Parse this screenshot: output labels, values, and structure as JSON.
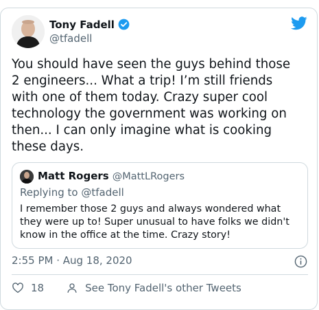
{
  "author": {
    "name": "Tony Fadell",
    "handle": "@tfadell",
    "verified_color": "#1d9bf0"
  },
  "tweet": {
    "text": "You should have seen the guys behind those\n2 engineers... What a trip! I’m still friends\nwith one of them today. Crazy super cool\ntechnology the government was working on\nthen... I can only imagine what is cooking\nthese days.",
    "timestamp": "2:55 PM · Aug 18, 2020"
  },
  "quoted": {
    "name": "Matt Rogers",
    "handle": "@MattLRogers",
    "replying_to": "Replying to @tfadell",
    "text": "I remember those 2 guys and always wondered what they were up to! Super unusual to have folks we didn't know in the office at the time. Crazy story!"
  },
  "actions": {
    "like_count": "18",
    "other_tweets_label": "See Tony Fadell's other Tweets"
  },
  "icons": {
    "brand": "twitter-bird-icon",
    "verified": "verified-badge-icon",
    "info": "info-icon",
    "like": "heart-icon",
    "profile": "person-icon"
  },
  "colors": {
    "brand": "#1d9bf0",
    "text": "#0f1419",
    "muted": "#536471",
    "border": "#cfd9de"
  }
}
